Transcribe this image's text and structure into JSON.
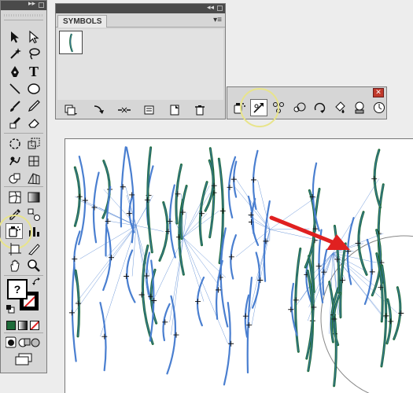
{
  "tools_panel": {
    "collapse_glyph": "▸▸",
    "type_tool_glyph": "T",
    "fill_glyph": "?",
    "tools": [
      "selection-tool",
      "direct-selection-tool",
      "magic-wand-tool",
      "lasso-tool",
      "pen-tool",
      "type-tool",
      "line-tool",
      "ellipse-tool",
      "paintbrush-tool",
      "pencil-tool",
      "blob-brush-tool",
      "eraser-tool",
      "rotate-tool",
      "scale-tool",
      "warp-tool",
      "free-transform-tool",
      "shape-builder-tool",
      "perspective-grid-tool",
      "mesh-tool",
      "gradient-tool",
      "eyedropper-tool",
      "blend-tool",
      "symbol-sprayer-tool",
      "column-graph-tool",
      "artboard-tool",
      "slice-tool",
      "hand-tool",
      "zoom-tool"
    ],
    "active_tool": "symbol-sprayer-tool"
  },
  "symbols_panel": {
    "collapse_glyph": "◂◂",
    "tab_label": "SYMBOLS",
    "menu_glyph": "▾≡",
    "footer_buttons": [
      "symbol-libraries-menu",
      "place-symbol-instance",
      "break-link-to-symbol",
      "symbol-options",
      "new-symbol",
      "delete-symbol"
    ]
  },
  "symbolism_tools": {
    "close_glyph": "✕",
    "tools": [
      "symbol-sprayer",
      "symbol-shifter",
      "symbol-scruncher",
      "symbol-sizer",
      "symbol-spinner",
      "symbol-stainer",
      "symbol-screener",
      "symbol-styler"
    ],
    "active_tool": "symbol-shifter"
  },
  "colors": {
    "highlight": "#e8e48a",
    "stroke_green": "#1e6b3a",
    "selection_blue": "#4a7fd0",
    "arrow_red": "#e02020"
  }
}
